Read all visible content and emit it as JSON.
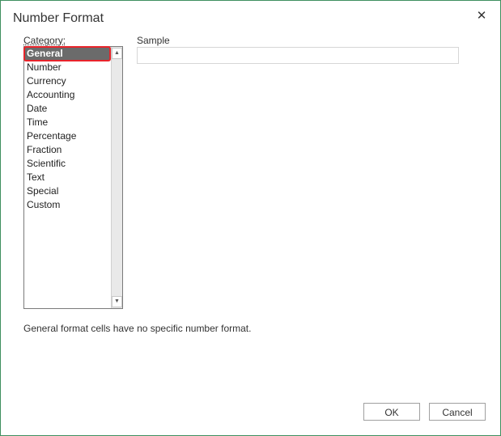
{
  "dialog": {
    "title": "Number Format",
    "close_glyph": "✕"
  },
  "category": {
    "label": "Category:",
    "items": [
      "General",
      "Number",
      "Currency",
      "Accounting",
      "Date",
      "Time",
      "Percentage",
      "Fraction",
      "Scientific",
      "Text",
      "Special",
      "Custom"
    ],
    "selected": "General"
  },
  "sample": {
    "label": "Sample",
    "value": ""
  },
  "scrollbar": {
    "up_glyph": "▲",
    "down_glyph": "▼"
  },
  "description": "General format cells have no specific number format.",
  "buttons": {
    "ok": "OK",
    "cancel": "Cancel"
  },
  "colors": {
    "selection_bg": "#6b6b6b",
    "highlight_outline": "#e8242b",
    "dialog_border": "#3f8f5f"
  }
}
